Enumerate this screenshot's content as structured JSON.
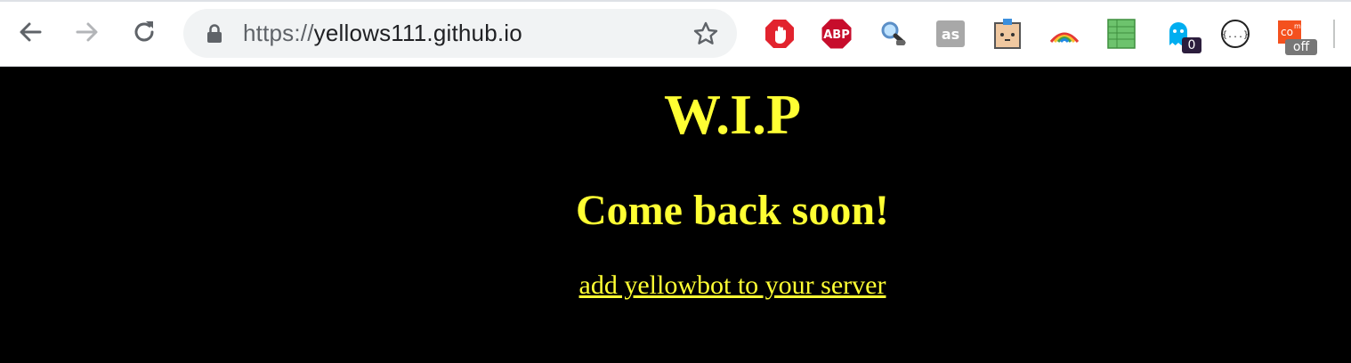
{
  "browser": {
    "url_scheme": "https://",
    "url_host": "yellows111.github.io"
  },
  "extensions": [
    {
      "name": "adblock",
      "badge": ""
    },
    {
      "name": "abp",
      "label": "ABP"
    },
    {
      "name": "magnifier"
    },
    {
      "name": "lastfm",
      "label": "as"
    },
    {
      "name": "box-face"
    },
    {
      "name": "rainbow"
    },
    {
      "name": "sheet"
    },
    {
      "name": "ghostery",
      "badge": "0"
    },
    {
      "name": "json"
    },
    {
      "name": "com-off",
      "badge": "off"
    }
  ],
  "page": {
    "heading": "W.I.P",
    "subheading": "Come back soon!",
    "link": "add yellowbot to your server"
  },
  "colors": {
    "page_bg": "#000000",
    "text": "#ffff33"
  }
}
